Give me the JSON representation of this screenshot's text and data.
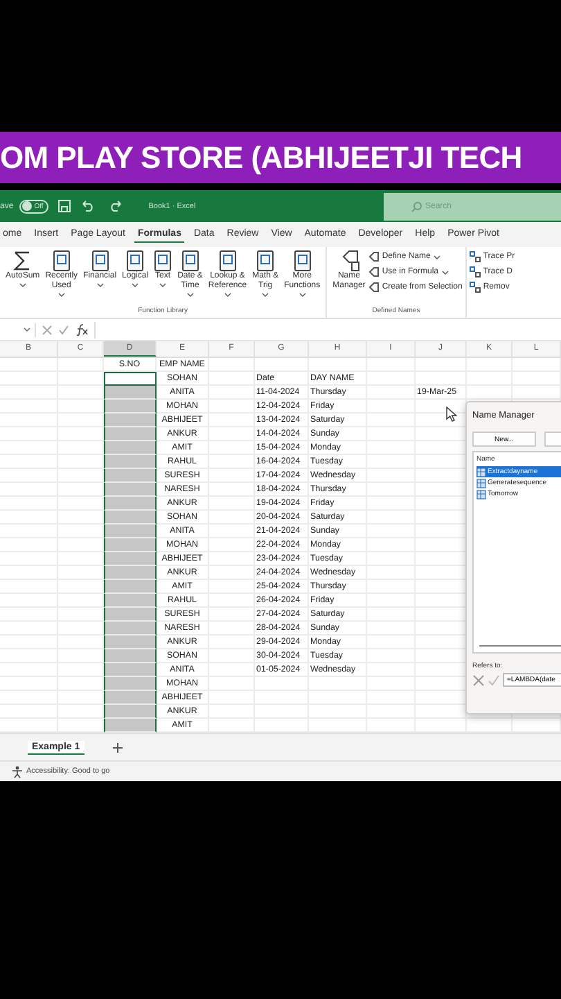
{
  "banner": {
    "text": "OM PLAY STORE (ABHIJEETJI TECH"
  },
  "title_bar": {
    "autosave_label": "ave",
    "autosave_toggle": {
      "label": "Off",
      "on": false
    },
    "document": "Book1 · Excel",
    "search": {
      "placeholder": "Search"
    }
  },
  "tabs": [
    {
      "label": "ome",
      "selected": false
    },
    {
      "label": "Insert",
      "selected": false
    },
    {
      "label": "Page Layout",
      "selected": false
    },
    {
      "label": "Formulas",
      "selected": true
    },
    {
      "label": "Data",
      "selected": false
    },
    {
      "label": "Review",
      "selected": false
    },
    {
      "label": "View",
      "selected": false
    },
    {
      "label": "Automate",
      "selected": false
    },
    {
      "label": "Developer",
      "selected": false
    },
    {
      "label": "Help",
      "selected": false
    },
    {
      "label": "Power Pivot",
      "selected": false
    }
  ],
  "function_library": {
    "label": "Function Library",
    "buttons": [
      {
        "kind": "sum",
        "lines": [
          "AutoSum"
        ],
        "dropdown": true
      },
      {
        "kind": "book",
        "lines": [
          "Recently",
          "Used"
        ],
        "dropdown": true
      },
      {
        "kind": "book",
        "lines": [
          "Financial"
        ],
        "dropdown": true
      },
      {
        "kind": "book",
        "lines": [
          "Logical"
        ],
        "dropdown": true
      },
      {
        "kind": "book",
        "lines": [
          "Text"
        ],
        "dropdown": true
      },
      {
        "kind": "book",
        "lines": [
          "Date &",
          "Time"
        ],
        "dropdown": true
      },
      {
        "kind": "book",
        "lines": [
          "Lookup &",
          "Reference"
        ],
        "dropdown": true
      },
      {
        "kind": "book",
        "lines": [
          "Math &",
          "Trig"
        ],
        "dropdown": true
      },
      {
        "kind": "book",
        "lines": [
          "More",
          "Functions"
        ],
        "dropdown": true
      }
    ]
  },
  "defined_names": {
    "label": "Defined Names",
    "manager": [
      "Name",
      "Manager"
    ],
    "items": [
      {
        "label": "Define Name",
        "dropdown": true
      },
      {
        "label": "Use in Formula",
        "dropdown": true
      },
      {
        "label": "Create from Selection",
        "dropdown": false
      }
    ]
  },
  "auditing": {
    "items": [
      "Trace Pr",
      "Trace D",
      "Remov"
    ]
  },
  "grid": {
    "columns": [
      {
        "label": "B",
        "selected": false
      },
      {
        "label": "C",
        "selected": false
      },
      {
        "label": "D",
        "selected": true
      },
      {
        "label": "E",
        "selected": false
      },
      {
        "label": "F",
        "selected": false
      },
      {
        "label": "G",
        "selected": false
      },
      {
        "label": "H",
        "selected": false
      },
      {
        "label": "I",
        "selected": false
      },
      {
        "label": "J",
        "selected": false
      },
      {
        "label": "K",
        "selected": false
      },
      {
        "label": "L",
        "selected": false
      }
    ],
    "rows": [
      {
        "D": "S.NO",
        "E": "EMP NAME",
        "selected": false,
        "active": false
      },
      {
        "E": "SOHAN",
        "G": "Date",
        "H": "DAY NAME",
        "selected": true,
        "active": true
      },
      {
        "E": "ANITA",
        "G": "11-04-2024",
        "H": "Thursday",
        "J": "19-Mar-25",
        "selected": true,
        "active": false
      },
      {
        "E": "MOHAN",
        "G": "12-04-2024",
        "H": "Friday",
        "selected": true,
        "active": false
      },
      {
        "E": "ABHIJEET",
        "G": "13-04-2024",
        "H": "Saturday",
        "selected": true,
        "active": false
      },
      {
        "E": "ANKUR",
        "G": "14-04-2024",
        "H": "Sunday",
        "selected": true,
        "active": false
      },
      {
        "E": "AMIT",
        "G": "15-04-2024",
        "H": "Monday",
        "selected": true,
        "active": false
      },
      {
        "E": "RAHUL",
        "G": "16-04-2024",
        "H": "Tuesday",
        "selected": true,
        "active": false
      },
      {
        "E": "SURESH",
        "G": "17-04-2024",
        "H": "Wednesday",
        "selected": true,
        "active": false
      },
      {
        "E": "NARESH",
        "G": "18-04-2024",
        "H": "Thursday",
        "selected": true,
        "active": false
      },
      {
        "E": "ANKUR",
        "G": "19-04-2024",
        "H": "Friday",
        "selected": true,
        "active": false
      },
      {
        "E": "SOHAN",
        "G": "20-04-2024",
        "H": "Saturday",
        "selected": true,
        "active": false
      },
      {
        "E": "ANITA",
        "G": "21-04-2024",
        "H": "Sunday",
        "selected": true,
        "active": false
      },
      {
        "E": "MOHAN",
        "G": "22-04-2024",
        "H": "Monday",
        "selected": true,
        "active": false
      },
      {
        "E": "ABHIJEET",
        "G": "23-04-2024",
        "H": "Tuesday",
        "selected": true,
        "active": false
      },
      {
        "E": "ANKUR",
        "G": "24-04-2024",
        "H": "Wednesday",
        "selected": true,
        "active": false
      },
      {
        "E": "AMIT",
        "G": "25-04-2024",
        "H": "Thursday",
        "selected": true,
        "active": false
      },
      {
        "E": "RAHUL",
        "G": "26-04-2024",
        "H": "Friday",
        "selected": true,
        "active": false
      },
      {
        "E": "SURESH",
        "G": "27-04-2024",
        "H": "Saturday",
        "selected": true,
        "active": false
      },
      {
        "E": "NARESH",
        "G": "28-04-2024",
        "H": "Sunday",
        "selected": true,
        "active": false
      },
      {
        "E": "ANKUR",
        "G": "29-04-2024",
        "H": "Monday",
        "selected": true,
        "active": false
      },
      {
        "E": "SOHAN",
        "G": "30-04-2024",
        "H": "Tuesday",
        "selected": true,
        "active": false
      },
      {
        "E": "ANITA",
        "G": "01-05-2024",
        "H": "Wednesday",
        "selected": true,
        "active": false
      },
      {
        "E": "MOHAN",
        "selected": true,
        "active": false
      },
      {
        "E": "ABHIJEET",
        "selected": true,
        "active": false
      },
      {
        "E": "ANKUR",
        "selected": true,
        "active": false
      },
      {
        "E": "AMIT",
        "selected": true,
        "active": false
      }
    ]
  },
  "name_manager": {
    "title": "Name Manager",
    "new_button": "New...",
    "name_column": "Name",
    "names": [
      {
        "name": "Extractdayname",
        "selected": true
      },
      {
        "name": "Generatesequence",
        "selected": false
      },
      {
        "name": "Tomorrow",
        "selected": false
      }
    ],
    "refers_to_label": "Refers to:",
    "refers_to_value": "=LAMBDA(date"
  },
  "sheet_tabs": [
    {
      "label": "Example 1",
      "selected": true
    }
  ],
  "status_bar": {
    "accessibility": "Accessibility: Good to go"
  }
}
